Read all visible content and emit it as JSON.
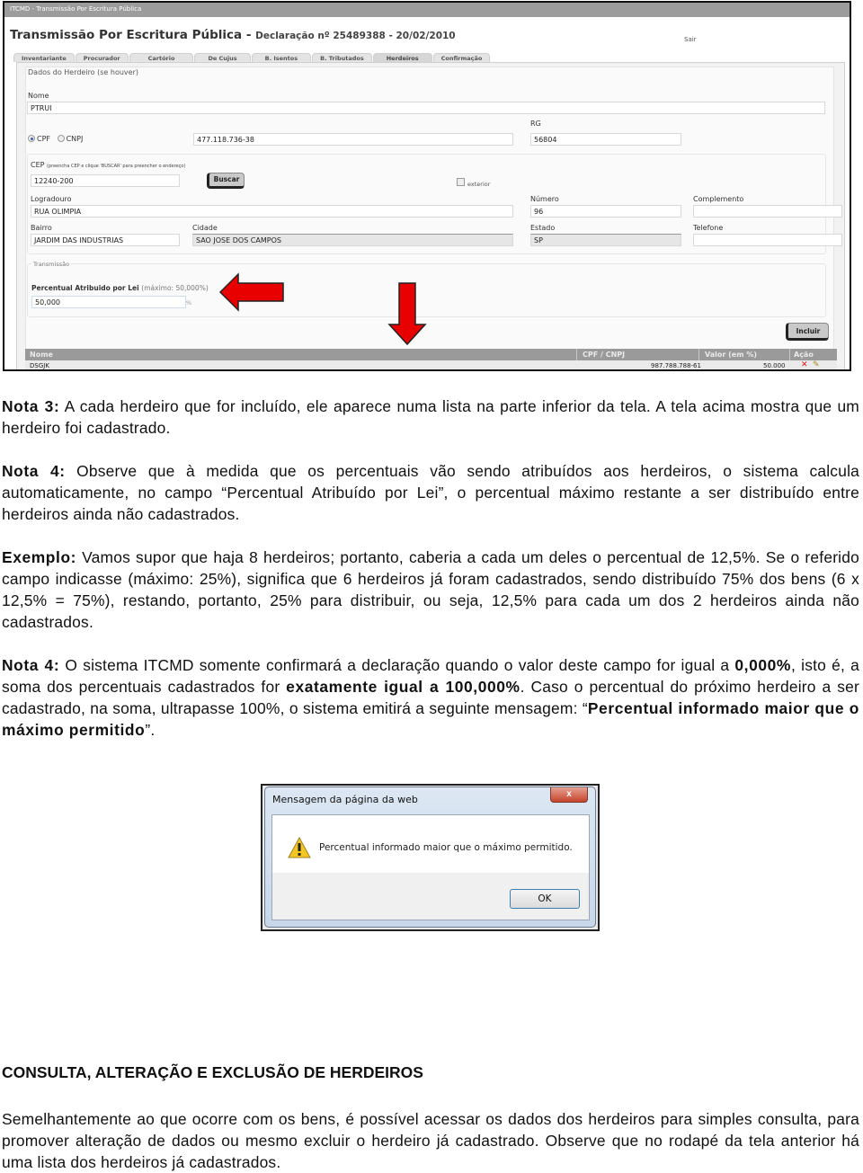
{
  "screenshot_form": {
    "window_title": "ITCMD - Transmissão Por Escritura Pública",
    "header_title": "Transmissão Por Escritura Pública - ",
    "header_subtitle": "Declaração nº 25489388 - 20/02/2010",
    "logout_link": "Sair",
    "tabs": [
      {
        "label": "Inventariante",
        "active": false
      },
      {
        "label": "Procurador",
        "active": false
      },
      {
        "label": "Cartório",
        "active": false
      },
      {
        "label": "De Cujus",
        "active": false
      },
      {
        "label": "B. Isentos",
        "active": false
      },
      {
        "label": "B. Tributados",
        "active": false
      },
      {
        "label": "Herdeiros",
        "active": true
      },
      {
        "label": "Confirmação",
        "active": false
      }
    ],
    "section_title": "Dados do Herdeiro (se houver)",
    "nome": {
      "label": "Nome",
      "value": "PTRUI"
    },
    "doc_type": {
      "options": [
        "CPF",
        "CNPJ"
      ],
      "selected": "CPF"
    },
    "cpf_value": "477.118.736-38",
    "rg": {
      "label": "RG",
      "value": "56804"
    },
    "cep": {
      "label": "CEP",
      "hint": "(preencha CEP e clique 'BUSCAR' para preencher o endereço)",
      "value": "12240-200"
    },
    "buscar_button": "Buscar",
    "exterior_checkbox": {
      "label": "exterior",
      "checked": false
    },
    "logradouro": {
      "label": "Logradouro",
      "value": "RUA OLIMPIA"
    },
    "numero": {
      "label": "Número",
      "value": "96"
    },
    "complemento": {
      "label": "Complemento",
      "value": ""
    },
    "bairro": {
      "label": "Bairro",
      "value": "JARDIM DAS INDUSTRIAS"
    },
    "cidade": {
      "label": "Cidade",
      "value": "SAO JOSE DOS CAMPOS"
    },
    "estado": {
      "label": "Estado",
      "value": "SP"
    },
    "telefone": {
      "label": "Telefone",
      "value": ""
    },
    "transmissao_title": "Transmissão",
    "percentual": {
      "label": "Percentual Atribuido por Lei",
      "max_hint": "(máximo: 50,000%)",
      "value": "50,000",
      "unit": "%"
    },
    "incluir_button": "Incluir",
    "grid": {
      "columns": [
        "Nome",
        "CPF / CNPJ",
        "Valor (em %)",
        "Ação"
      ],
      "rows": [
        {
          "nome": "DSGJK",
          "cpf_cnpj": "987.788.788-61",
          "valor": "50.000",
          "actions": [
            "delete-icon",
            "edit-icon"
          ]
        }
      ]
    },
    "annotation_color": "#e00000"
  },
  "doc": {
    "nota3_label": "Nota 3:",
    "nota3_text": " A cada herdeiro que for incluído, ele aparece numa lista na parte inferior da tela. A tela acima  mostra que um herdeiro foi cadastrado.",
    "nota4a_label": "Nota 4:",
    "nota4a_text": " Observe que à medida que os percentuais vão sendo atribuídos aos herdeiros, o sistema calcula automaticamente, no campo “Percentual Atribuído por Lei”, o percentual máximo restante a ser distribuído entre herdeiros ainda não cadastrados.",
    "exemplo_label": "Exemplo:",
    "exemplo_text": " Vamos supor que haja 8 herdeiros; portanto, caberia a cada um deles o percentual de 12,5%. Se o referido campo indicasse (máximo: 25%), significa que 6 herdeiros já foram cadastrados, sendo distribuído 75% dos bens (6 x 12,5% = 75%), restando, portanto, 25% para distribuir, ou seja, 12,5% para cada um dos 2 herdeiros ainda não cadastrados.",
    "nota4b_label": "Nota 4:",
    "nota4b_t1": " O sistema ITCMD somente confirmará a declaração quando o valor deste campo for igual a ",
    "nota4b_b1": "0,000%",
    "nota4b_t2": ", isto é, a soma dos percentuais cadastrados for ",
    "nota4b_b2": "exatamente igual a 100,000%",
    "nota4b_t3": ". Caso o percentual do próximo herdeiro a ser cadastrado, na soma, ultrapasse 100%, o sistema emitirá a seguinte mensagem: “",
    "nota4b_b3": "Percentual informado maior que o máximo permitido",
    "nota4b_t4": "”.",
    "section_heading": "CONSULTA, ALTERAÇÃO E EXCLUSÃO DE HERDEIROS",
    "final_paragraph": "Semelhantemente ao que ocorre com os bens, é possível acessar os dados dos herdeiros para simples consulta, para promover alteração de dados ou mesmo excluir o herdeiro já cadastrado. Observe que no rodapé da tela anterior há uma lista dos herdeiros já cadastrados."
  },
  "screenshot_dialog": {
    "title": "Mensagem da página da web",
    "close_label": "x",
    "message": "Percentual informado maior que o máximo permitido.",
    "ok_button": "OK"
  }
}
